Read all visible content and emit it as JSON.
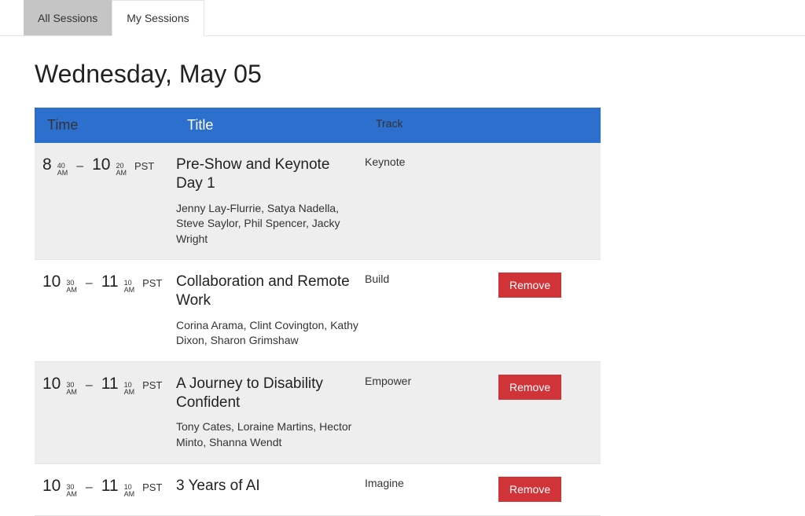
{
  "tabs": {
    "all": "All Sessions",
    "my": "My Sessions"
  },
  "day_heading": "Wednesday, May 05",
  "headers": {
    "time": "Time",
    "title": "Title",
    "track": "Track"
  },
  "sessions": [
    {
      "start_hour": "8",
      "start_min": "40",
      "start_ampm": "AM",
      "end_hour": "10",
      "end_min": "20",
      "end_ampm": "AM",
      "tz": "PST",
      "title": "Pre-Show and Keynote Day 1",
      "speakers": "Jenny Lay-Flurrie, Satya Nadella, Steve Saylor, Phil Spencer, Jacky Wright",
      "track": "Keynote",
      "removable": false
    },
    {
      "start_hour": "10",
      "start_min": "30",
      "start_ampm": "AM",
      "end_hour": "11",
      "end_min": "10",
      "end_ampm": "AM",
      "tz": "PST",
      "title": "Collaboration and Remote Work",
      "speakers": "Corina Arama, Clint Covington, Kathy Dixon, Sharon Grimshaw",
      "track": "Build",
      "removable": true
    },
    {
      "start_hour": "10",
      "start_min": "30",
      "start_ampm": "AM",
      "end_hour": "11",
      "end_min": "10",
      "end_ampm": "AM",
      "tz": "PST",
      "title": "A Journey to Disability Confident",
      "speakers": "Tony Cates, Loraine Martins, Hector Minto, Shanna Wendt",
      "track": "Empower",
      "removable": true
    },
    {
      "start_hour": "10",
      "start_min": "30",
      "start_ampm": "AM",
      "end_hour": "11",
      "end_min": "10",
      "end_ampm": "AM",
      "tz": "PST",
      "title": "3 Years of AI",
      "speakers": "",
      "track": "Imagine",
      "removable": true
    }
  ],
  "remove_label": "Remove"
}
